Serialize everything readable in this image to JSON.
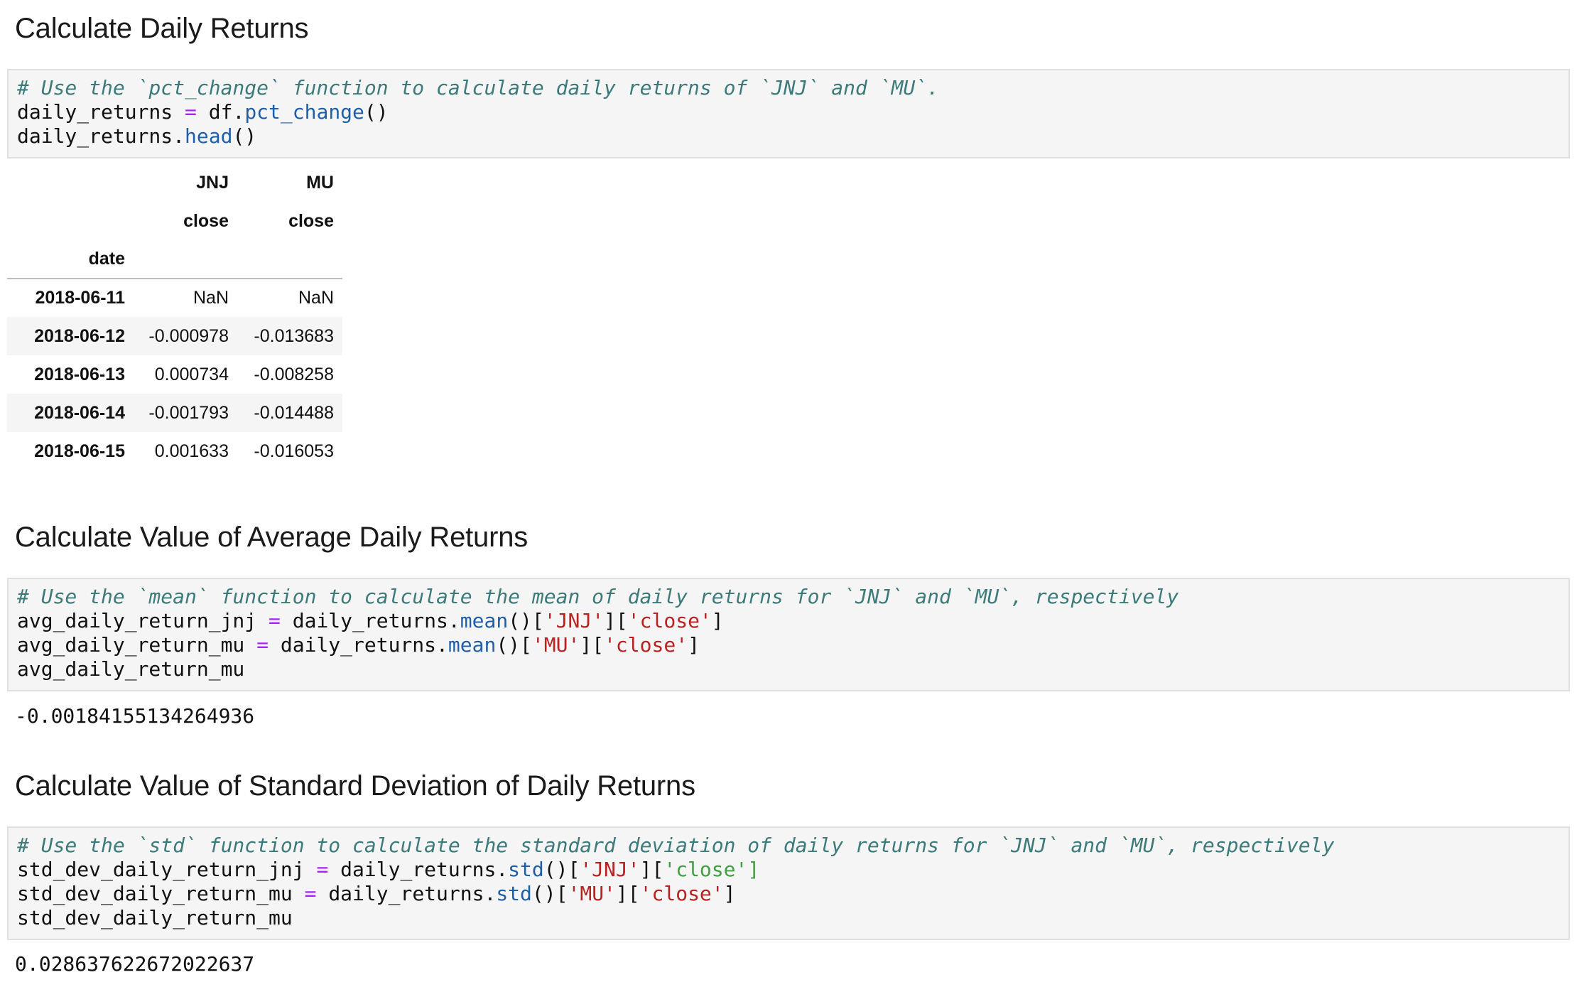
{
  "sections": [
    {
      "heading": "Calculate Daily Returns",
      "code": {
        "comment": "# Use the `pct_change` function to calculate daily returns of `JNJ` and `MU`.",
        "line1": {
          "var": "daily_returns",
          "op": "=",
          "obj": "df.",
          "fn": "pct_change",
          "tail": "()"
        },
        "line2": {
          "obj": "daily_returns.",
          "fn": "head",
          "tail": "()"
        }
      },
      "table": {
        "columns_level0": [
          "JNJ",
          "MU"
        ],
        "columns_level1": [
          "close",
          "close"
        ],
        "index_name": "date",
        "rows": [
          {
            "date": "2018-06-11",
            "jnj": "NaN",
            "mu": "NaN"
          },
          {
            "date": "2018-06-12",
            "jnj": "-0.000978",
            "mu": "-0.013683"
          },
          {
            "date": "2018-06-13",
            "jnj": "0.000734",
            "mu": "-0.008258"
          },
          {
            "date": "2018-06-14",
            "jnj": "-0.001793",
            "mu": "-0.014488"
          },
          {
            "date": "2018-06-15",
            "jnj": "0.001633",
            "mu": "-0.016053"
          }
        ]
      }
    },
    {
      "heading": "Calculate Value of Average Daily Returns",
      "code": {
        "comment": "# Use the `mean` function to calculate the mean of daily returns for `JNJ` and `MU`, respectively",
        "line1": {
          "var": "avg_daily_return_jnj",
          "op": "=",
          "obj": "daily_returns.",
          "fn": "mean",
          "p1": "()[",
          "s1": "'JNJ'",
          "p2": "][",
          "s2": "'close'",
          "p3": "]"
        },
        "line2": {
          "var": "avg_daily_return_mu",
          "op": "=",
          "obj": "daily_returns.",
          "fn": "mean",
          "p1": "()[",
          "s1": "'MU'",
          "p2": "][",
          "s2": "'close'",
          "p3": "]"
        },
        "line3": "avg_daily_return_mu"
      },
      "output": "-0.00184155134264936"
    },
    {
      "heading": "Calculate Value of Standard Deviation of Daily Returns",
      "code": {
        "comment": "# Use the `std` function to calculate the standard deviation of daily returns for `JNJ` and `MU`, respectively",
        "line1": {
          "var": "std_dev_daily_return_jnj",
          "op": "=",
          "obj": "daily_returns.",
          "fn": "std",
          "p1": "()[",
          "s1": "'JNJ'",
          "p2": "][",
          "s2": "'close'",
          "p3": "]"
        },
        "line2": {
          "var": "std_dev_daily_return_mu",
          "op": "=",
          "obj": "daily_returns.",
          "fn": "std",
          "p1": "()[",
          "s1": "'MU'",
          "p2": "][",
          "s2": "'close'",
          "p3": "]"
        },
        "line3": "std_dev_daily_return_mu"
      },
      "output": "0.028637622672022637"
    }
  ],
  "colors": {
    "comment": "#3d7a7a",
    "operator": "#aa22ff",
    "function": "#1f5fa8",
    "string": "#ba2121",
    "string_highlight": "#40a040",
    "cell_background": "#f5f5f5"
  }
}
